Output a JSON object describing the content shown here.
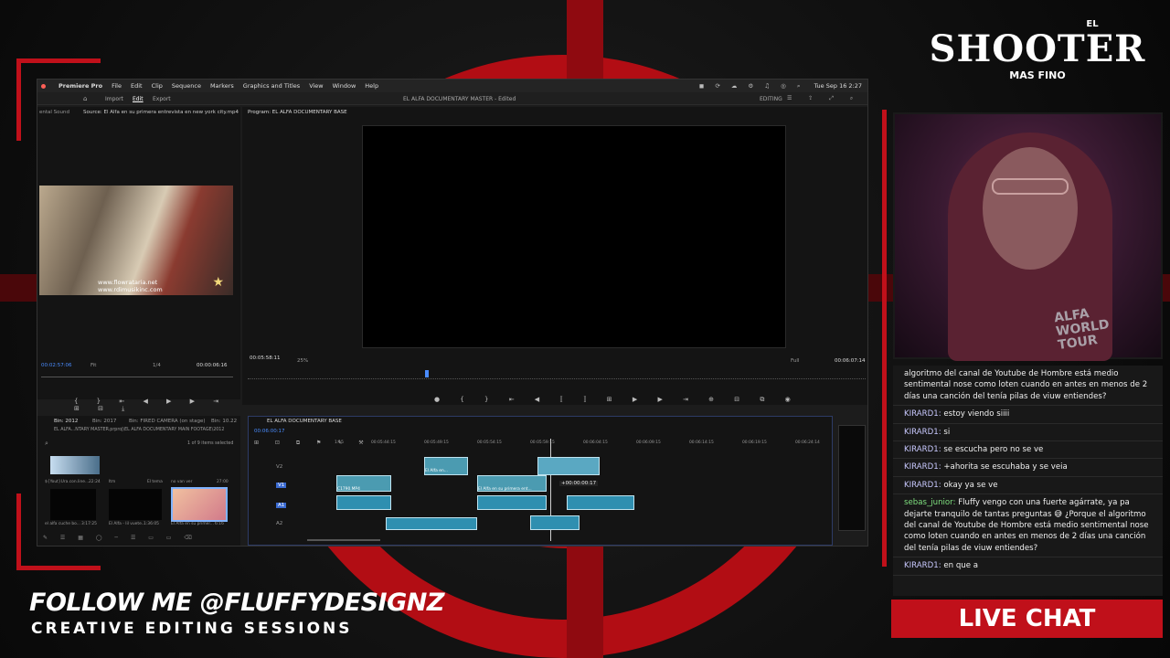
{
  "colors": {
    "accent_red": "#c0101a",
    "clip_video": "#4b9bb1",
    "clip_audio": "#2f8fb0",
    "playhead_blue": "#4a8cff"
  },
  "brand": {
    "line1": "EL",
    "line2": "SHOOTER",
    "line3": "MAS FINO"
  },
  "overlay": {
    "follow": "FOLLOW ME @FLUFFYDESIGNZ",
    "tagline": "CREATIVE EDITING SESSIONS"
  },
  "live_chat_label": "LIVE CHAT",
  "webcam": {
    "shirt_text": "ALFA WORLD TOUR"
  },
  "premiere": {
    "menu": [
      "Premiere Pro",
      "File",
      "Edit",
      "Clip",
      "Sequence",
      "Markers",
      "Graphics and Titles",
      "View",
      "Window",
      "Help"
    ],
    "clock": "Tue Sep 16 2:27",
    "tabs": [
      "Import",
      "Edit",
      "Export"
    ],
    "window_title": "EL ALFA DOCUMENTARY MASTER - Edited",
    "workspace": "EDITING",
    "source": {
      "panel_label": "ental Sound",
      "source_label": "Source: El Alfa en su primera entrevista en new york city.mp4",
      "watermark1": "www.flowrataria.net",
      "watermark2": "www.rdimusikinc.com",
      "timecode_in": "00:02:57:06",
      "fit": "Fit",
      "res": "1/4",
      "duration": "00:00:06:16"
    },
    "program": {
      "label": "Program: EL ALFA DOCUMENTARY BASE",
      "timecode": "00:05:58:11",
      "zoom": "25%",
      "quality": "Full",
      "duration": "00:06:07:14"
    },
    "project": {
      "tabs": [
        "Bin: 2012",
        "Bin: 2017",
        "Bin: FIRED CAMERA (on stage)",
        "Bin: 10.22"
      ],
      "path": "EL ALFA...NTARY MASTER.prproj\\EL ALFA DOCUMENTARY MAIN FOOTAGE\\2012",
      "selected": "1 of 9 items selected",
      "items": [
        {
          "name": "${Yout}Ura.con.line...",
          "dur": "22:24"
        },
        {
          "name": "Itm",
          "dur": ""
        },
        {
          "name": "El tema",
          "dur": ""
        },
        {
          "name": "no van ver",
          "dur": "27:00"
        },
        {
          "name": "el alfa cuche bo...",
          "dur": "3:17:25"
        },
        {
          "name": "El Alfa - lil vuete...",
          "dur": "1:36:05"
        },
        {
          "name": "El Alfa en su primer...",
          "dur": "6:16"
        }
      ]
    },
    "timeline": {
      "label": "EL ALFA DOCUMENTARY BASE",
      "timecode": "00:06:00:17",
      "ruler": [
        "1:15",
        "00:05:44:15",
        "00:05:49:15",
        "00:05:54:15",
        "00:05:59:15",
        "00:06:04:15",
        "00:06:09:15",
        "00:06:14:15",
        "00:06:19:15",
        "00:06:24:14"
      ],
      "tracks": [
        "V2",
        "V1",
        "A1",
        "A2"
      ],
      "clip_names": [
        "El Alfa en...",
        "El Alfa en su primera ent...",
        "C1790.MP4"
      ],
      "drag_readout": "+00:00:00:17"
    }
  },
  "chat": [
    {
      "user": "",
      "text": "algoritmo del canal de Youtube de Hombre está medio sentimental nose como loten cuando en antes en menos de 2 días una canción del tenía pilas de viuw entiendes?"
    },
    {
      "user": "KIRARD1:",
      "text": "estoy viendo siiii"
    },
    {
      "user": "KIRARD1:",
      "text": "si"
    },
    {
      "user": "KIRARD1:",
      "text": "se escucha pero no se ve"
    },
    {
      "user": "KIRARD1:",
      "text": "+ahorita se escuhaba y se veia"
    },
    {
      "user": "KIRARD1:",
      "text": "okay ya se ve"
    },
    {
      "user": "sebas_junior:",
      "text": "Fluffy vengo con una fuerte agárrate, ya pa dejarte tranquilo de tantas preguntas 😅 ¿Porque el algoritmo del canal de Youtube de Hombre está medio sentimental nose como loten cuando en antes en menos de 2 días una canción del tenía pilas de viuw entiendes?"
    },
    {
      "user": "KIRARD1:",
      "text": "en que a"
    }
  ]
}
